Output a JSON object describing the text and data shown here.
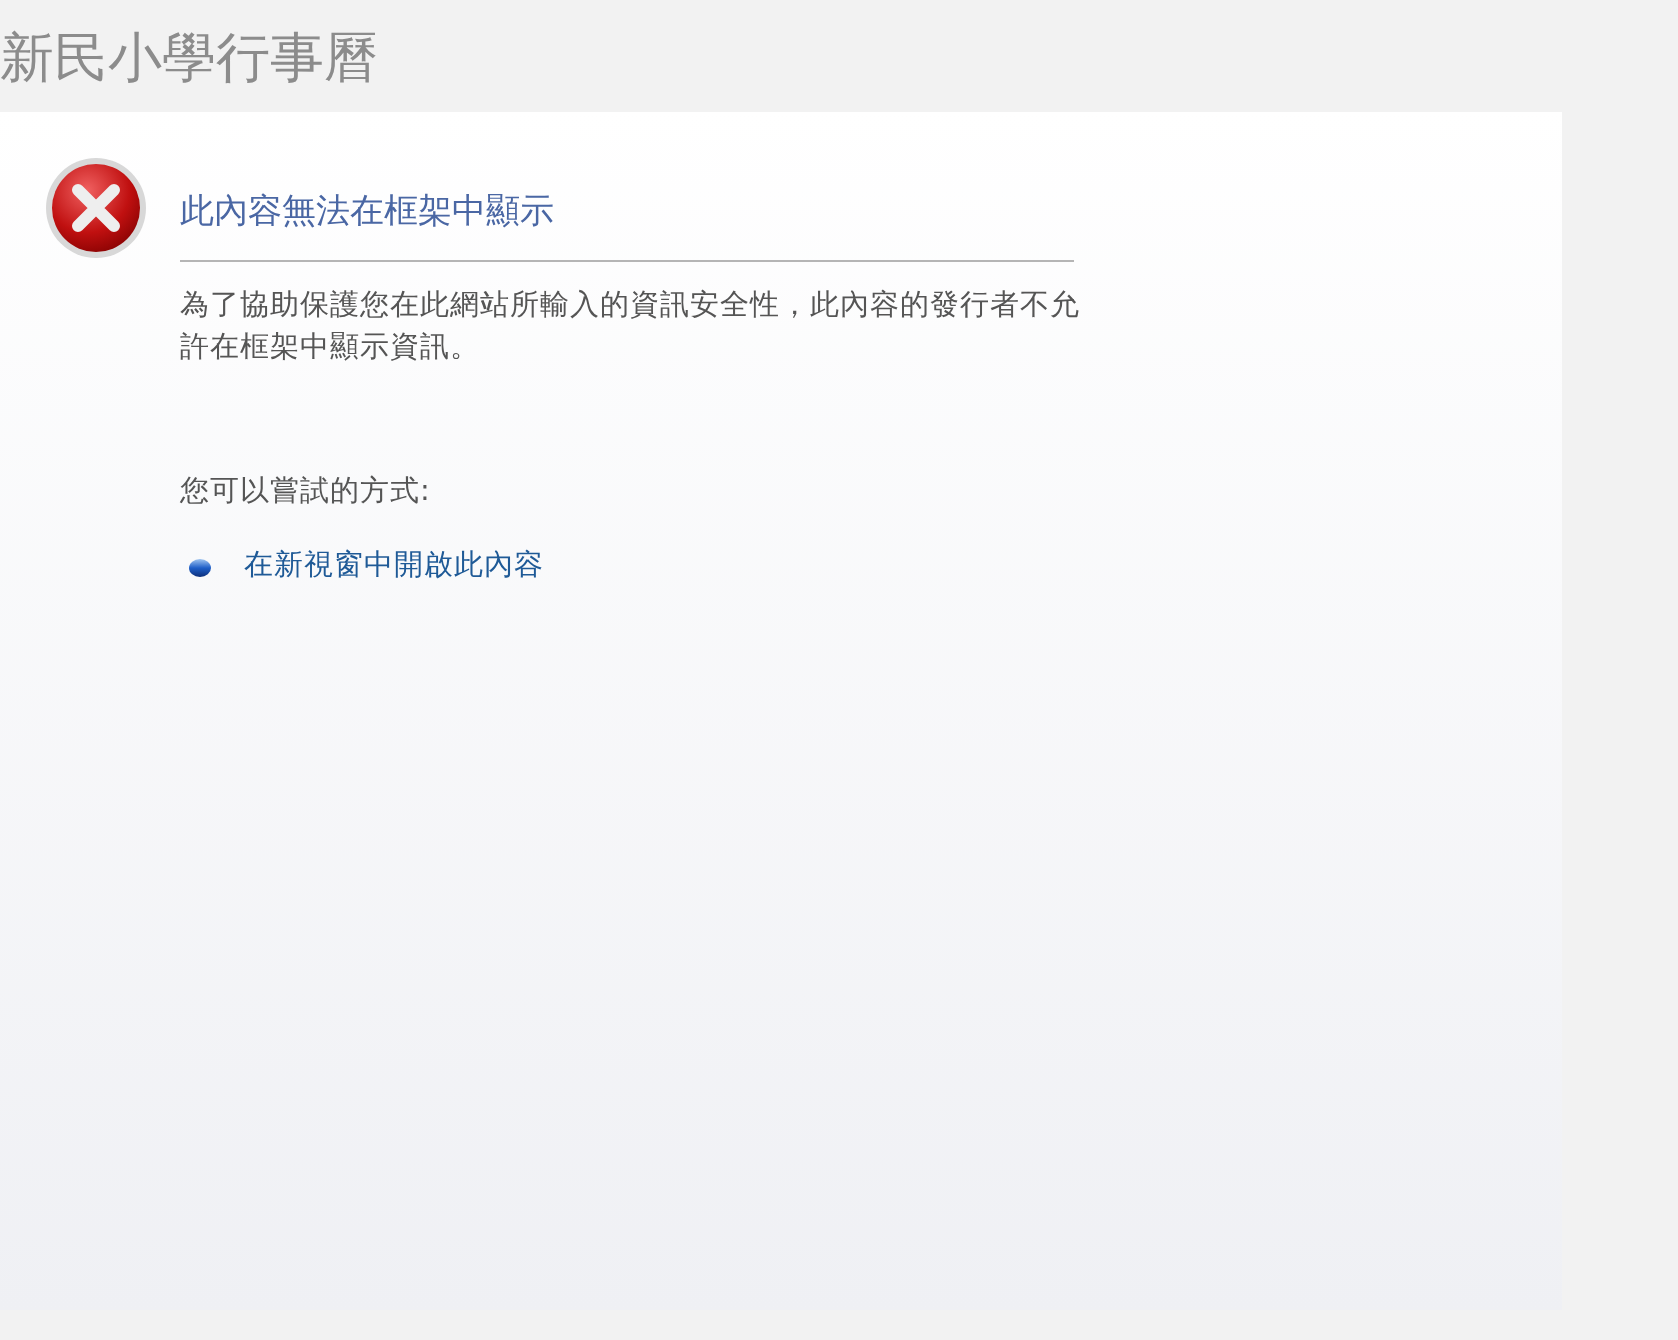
{
  "page_title": "新民小學行事曆",
  "error": {
    "heading": "此內容無法在框架中顯示",
    "message": "為了協助保護您在此網站所輸入的資訊安全性，此內容的發行者不允許在框架中顯示資訊。",
    "suggestions_label": "您可以嘗試的方式:",
    "links": [
      "在新視窗中開啟此內容"
    ]
  }
}
